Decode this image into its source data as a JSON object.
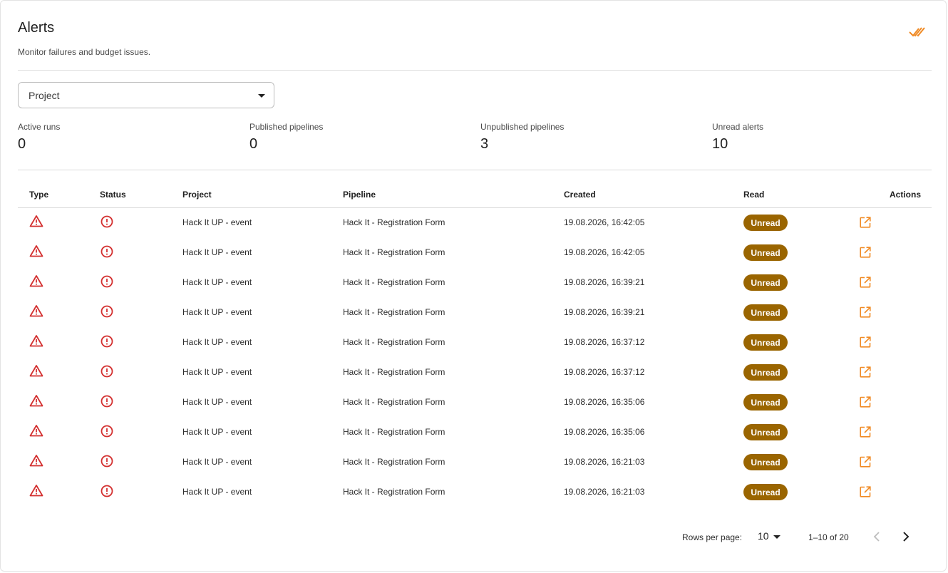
{
  "header": {
    "title": "Alerts",
    "subtitle": "Monitor failures and budget issues."
  },
  "filter": {
    "project_label": "Project"
  },
  "stats": [
    {
      "label": "Active runs",
      "value": "0"
    },
    {
      "label": "Published pipelines",
      "value": "0"
    },
    {
      "label": "Unpublished pipelines",
      "value": "3"
    },
    {
      "label": "Unread alerts",
      "value": "10"
    }
  ],
  "table": {
    "columns": [
      "Type",
      "Status",
      "Project",
      "Pipeline",
      "Created",
      "Read",
      "Actions"
    ],
    "rows": [
      {
        "project": "Hack It UP - event",
        "pipeline": "Hack It - Registration Form",
        "created": "19.08.2026, 16:42:05",
        "read": "Unread"
      },
      {
        "project": "Hack It UP - event",
        "pipeline": "Hack It - Registration Form",
        "created": "19.08.2026, 16:42:05",
        "read": "Unread"
      },
      {
        "project": "Hack It UP - event",
        "pipeline": "Hack It - Registration Form",
        "created": "19.08.2026, 16:39:21",
        "read": "Unread"
      },
      {
        "project": "Hack It UP - event",
        "pipeline": "Hack It - Registration Form",
        "created": "19.08.2026, 16:39:21",
        "read": "Unread"
      },
      {
        "project": "Hack It UP - event",
        "pipeline": "Hack It - Registration Form",
        "created": "19.08.2026, 16:37:12",
        "read": "Unread"
      },
      {
        "project": "Hack It UP - event",
        "pipeline": "Hack It - Registration Form",
        "created": "19.08.2026, 16:37:12",
        "read": "Unread"
      },
      {
        "project": "Hack It UP - event",
        "pipeline": "Hack It - Registration Form",
        "created": "19.08.2026, 16:35:06",
        "read": "Unread"
      },
      {
        "project": "Hack It UP - event",
        "pipeline": "Hack It - Registration Form",
        "created": "19.08.2026, 16:35:06",
        "read": "Unread"
      },
      {
        "project": "Hack It UP - event",
        "pipeline": "Hack It - Registration Form",
        "created": "19.08.2026, 16:21:03",
        "read": "Unread"
      },
      {
        "project": "Hack It UP - event",
        "pipeline": "Hack It - Registration Form",
        "created": "19.08.2026, 16:21:03",
        "read": "Unread"
      }
    ]
  },
  "pagination": {
    "rows_per_page_label": "Rows per page:",
    "rows_per_page": "10",
    "range": "1–10 of 20"
  },
  "icons": {
    "mark_all_read": "double-check-icon",
    "type": "warning-triangle-icon",
    "status": "error-circle-icon",
    "action": "open-in-new-icon",
    "prev": "chevron-left-icon",
    "next": "chevron-right-icon"
  },
  "colors": {
    "accent": "#f08a24",
    "error": "#d32f2f",
    "badge": "#9a6500"
  }
}
